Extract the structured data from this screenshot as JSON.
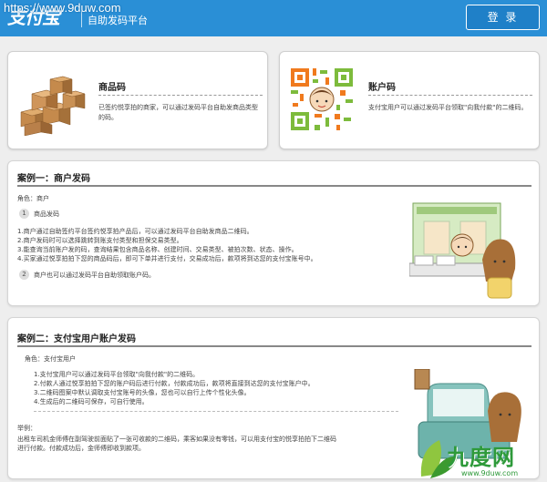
{
  "header": {
    "logo": "支付宝",
    "subtitle": "自助发码平台",
    "watermark": "https://www.9duw.com",
    "login_label": "登 录"
  },
  "products": [
    {
      "title": "商品码",
      "desc": "已签约悦享拍的商家，可以通过发码平台自助发商品类型的码。",
      "icon": "boxes-icon"
    },
    {
      "title": "账户码",
      "desc": "支付宝用户可以通过发码平台领取\"向我付款\"的二维码。",
      "icon": "qr-code-icon"
    }
  ],
  "case1": {
    "title": "案例一：商户发码",
    "role": "角色：商户",
    "item1_num": "1",
    "item1_label": "商品发码",
    "lines": [
      "1.商户通过自助签约平台签约悦享拍产品后，可以通过发码平台自助发商品二维码。",
      "2.商户发码时可以选择跳转到账支付类型和担保交易类型。",
      "3.能查询当前账户发的码，查询结果包含商品名称、创建时间、交易类型、被拍次数、状态、操作。",
      "4.买家通过悦享拍拍下您的商品码后，即可下单并进行支付，交易成功后，款项将到达您的支付宝账号中。"
    ],
    "item2_num": "2",
    "item2_label": "商户也可以通过发码平台自助领取账户码。"
  },
  "case2": {
    "title": "案例二：支付宝用户账户发码",
    "role": "角色：支付宝用户",
    "lines": [
      "1.支付宝用户可以通过发码平台领取\"向我付款\"的二维码。",
      "2.付款人通过悦享拍拍下您的账户码后进行付款，付款成功后，款项将直接到达您的支付宝账户中。",
      "3.二维码图案中默认调取支付宝账号的头像，您也可以自行上传个性化头像。",
      "4.生成后的二维码可保存，可自行使用。"
    ],
    "example_label": "举例：",
    "example_lines": [
      "出租车司机金师傅在副驾驶前面贴了一张可收款的二维码，乘客如果没有零钱，可以用支付宝的悦享拍拍下二维码",
      "进行付款。付款成功后，金师傅即收到款项。"
    ]
  },
  "footer": {
    "brand": "九度网",
    "url": "www.9duw.com"
  },
  "colors": {
    "header_blue": "#2a8fd6",
    "qr_orange": "#f07a1e",
    "qr_green": "#7dbb3c"
  }
}
